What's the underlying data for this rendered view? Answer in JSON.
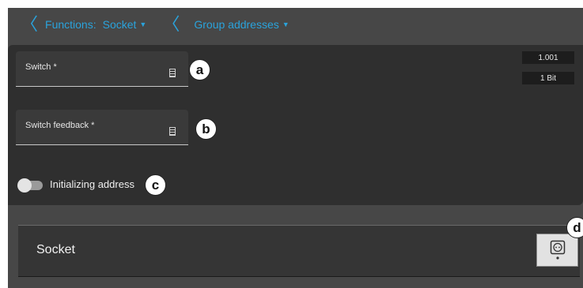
{
  "breadcrumb": {
    "functions_label": "Functions:",
    "socket_label": "Socket",
    "group_addresses_label": "Group addresses"
  },
  "fields": [
    {
      "label": "Switch *",
      "tag": "a"
    },
    {
      "label": "Switch feedback *",
      "tag": "b"
    }
  ],
  "datapoint": {
    "type": "1.001",
    "size": "1 Bit"
  },
  "initializing": {
    "label": "Initializing address",
    "tag": "c",
    "enabled": false
  },
  "card": {
    "title": "Socket",
    "tag": "d"
  },
  "icons": {
    "back": "chevron-left-icon",
    "dropdown": "caret-down-icon",
    "document": "document-icon",
    "socket": "socket-icon"
  },
  "colors": {
    "accent": "#2aa3dc",
    "panel": "#2f2f2f",
    "background": "#474747"
  }
}
